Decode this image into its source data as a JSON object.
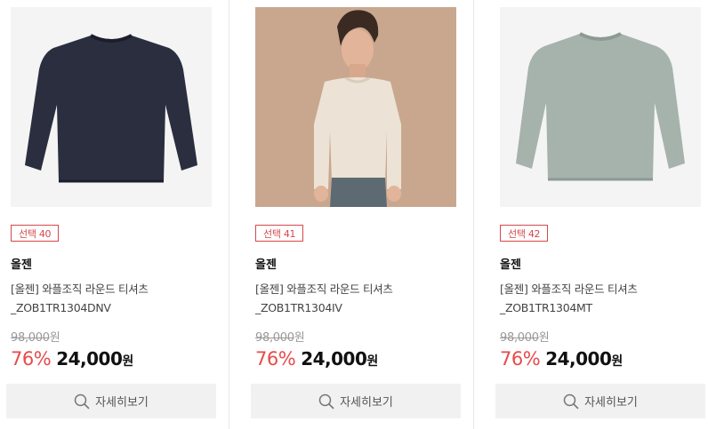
{
  "products": [
    {
      "badge": "선택 40",
      "brand": "올젠",
      "name": "[올젠] 와플조직 라운드 티셔츠_ZOB1TR1304DNV",
      "old_price": "98,000",
      "old_price_unit": "원",
      "rate": "76%",
      "sale_price": "24,000",
      "sale_unit": "원",
      "button_label": "자세히보기",
      "color": "#2b2e3f"
    },
    {
      "badge": "선택 41",
      "brand": "올젠",
      "name": "[올젠] 와플조직 라운드 티셔츠_ZOB1TR1304IV",
      "old_price": "98,000",
      "old_price_unit": "원",
      "rate": "76%",
      "sale_price": "24,000",
      "sale_unit": "원",
      "button_label": "자세히보기",
      "color": "#ece3d6"
    },
    {
      "badge": "선택 42",
      "brand": "올젠",
      "name": "[올젠] 와플조직 라운드 티셔츠_ZOB1TR1304MT",
      "old_price": "98,000",
      "old_price_unit": "원",
      "rate": "76%",
      "sale_price": "24,000",
      "sale_unit": "원",
      "button_label": "자세히보기",
      "color": "#a6b3ad"
    }
  ],
  "colors": {
    "badge": "#d64848",
    "discount_rate": "#e84a4a",
    "button_bg": "#f1f1f1",
    "divider": "#e6e6e6"
  }
}
